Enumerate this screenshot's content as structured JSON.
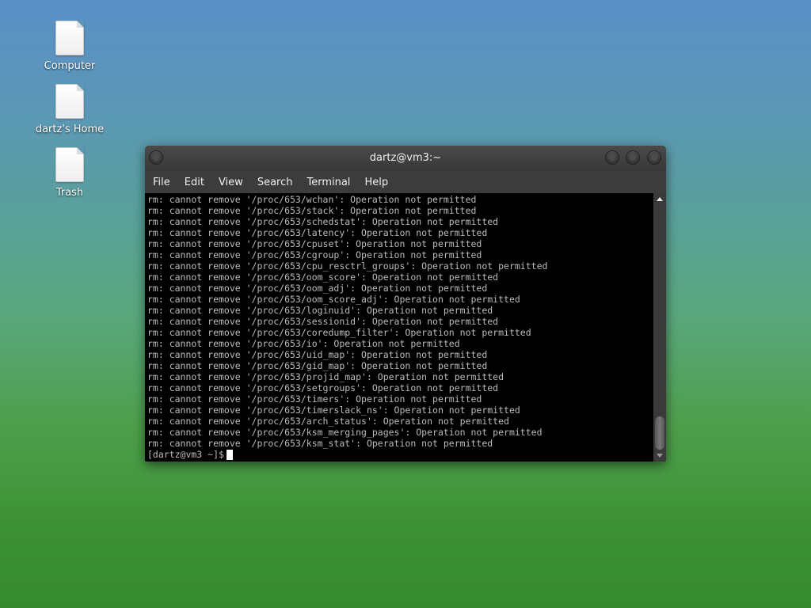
{
  "desktop": {
    "icons": [
      {
        "label": "Computer"
      },
      {
        "label": "dartz's Home"
      },
      {
        "label": "Trash"
      }
    ]
  },
  "window": {
    "title": "dartz@vm3:~",
    "menu": [
      "File",
      "Edit",
      "View",
      "Search",
      "Terminal",
      "Help"
    ]
  },
  "terminal": {
    "lines": [
      "rm: cannot remove '/proc/653/wchan': Operation not permitted",
      "rm: cannot remove '/proc/653/stack': Operation not permitted",
      "rm: cannot remove '/proc/653/schedstat': Operation not permitted",
      "rm: cannot remove '/proc/653/latency': Operation not permitted",
      "rm: cannot remove '/proc/653/cpuset': Operation not permitted",
      "rm: cannot remove '/proc/653/cgroup': Operation not permitted",
      "rm: cannot remove '/proc/653/cpu_resctrl_groups': Operation not permitted",
      "rm: cannot remove '/proc/653/oom_score': Operation not permitted",
      "rm: cannot remove '/proc/653/oom_adj': Operation not permitted",
      "rm: cannot remove '/proc/653/oom_score_adj': Operation not permitted",
      "rm: cannot remove '/proc/653/loginuid': Operation not permitted",
      "rm: cannot remove '/proc/653/sessionid': Operation not permitted",
      "rm: cannot remove '/proc/653/coredump_filter': Operation not permitted",
      "rm: cannot remove '/proc/653/io': Operation not permitted",
      "rm: cannot remove '/proc/653/uid_map': Operation not permitted",
      "rm: cannot remove '/proc/653/gid_map': Operation not permitted",
      "rm: cannot remove '/proc/653/projid_map': Operation not permitted",
      "rm: cannot remove '/proc/653/setgroups': Operation not permitted",
      "rm: cannot remove '/proc/653/timers': Operation not permitted",
      "rm: cannot remove '/proc/653/timerslack_ns': Operation not permitted",
      "rm: cannot remove '/proc/653/arch_status': Operation not permitted",
      "rm: cannot remove '/proc/653/ksm_merging_pages': Operation not permitted",
      "rm: cannot remove '/proc/653/ksm_stat': Operation not permitted"
    ],
    "prompt": "[dartz@vm3 ~]$"
  }
}
